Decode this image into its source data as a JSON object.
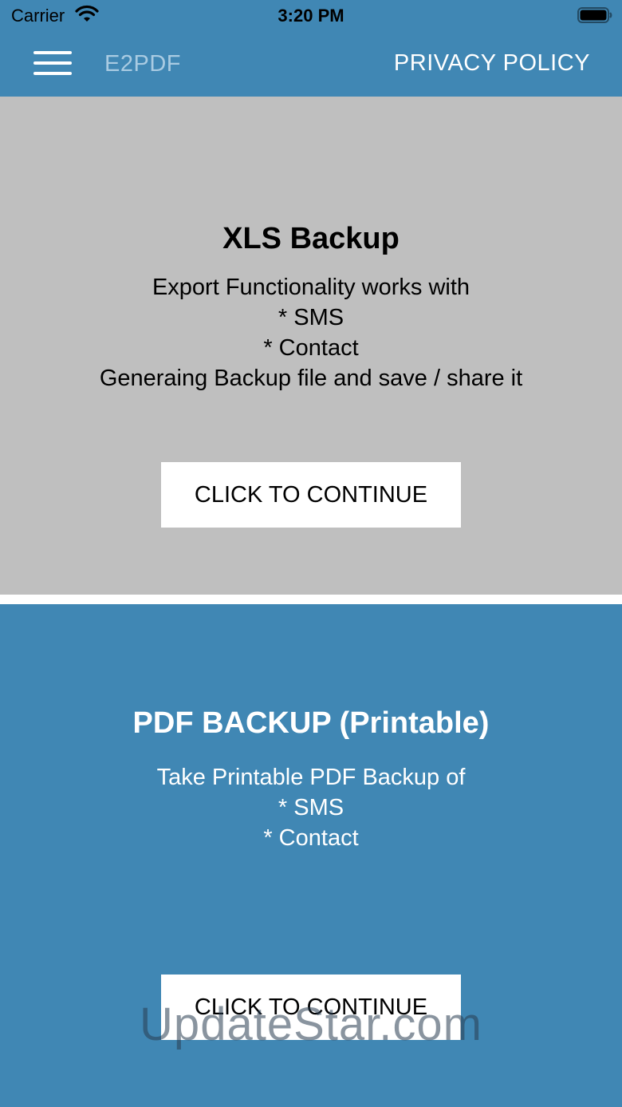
{
  "status_bar": {
    "carrier": "Carrier",
    "time": "3:20 PM"
  },
  "navbar": {
    "menu_icon": "hamburger-menu-icon",
    "title": "E2PDF",
    "privacy_link": "PRIVACY POLICY"
  },
  "cards": {
    "xls": {
      "title": "XLS Backup",
      "lines": [
        "Export Functionality works with",
        "* SMS",
        "* Contact",
        "Generaing Backup file and save / share it"
      ],
      "button": "CLICK TO CONTINUE"
    },
    "pdf": {
      "title": "PDF BACKUP (Printable)",
      "lines": [
        "Take Printable PDF Backup of",
        "* SMS",
        "* Contact"
      ],
      "button": "CLICK TO CONTINUE"
    }
  },
  "watermark": "UpdateStar.com",
  "colors": {
    "primary": "#4087b4",
    "card_gray": "#bfbfbf",
    "title_faded": "#a9cbe2"
  }
}
